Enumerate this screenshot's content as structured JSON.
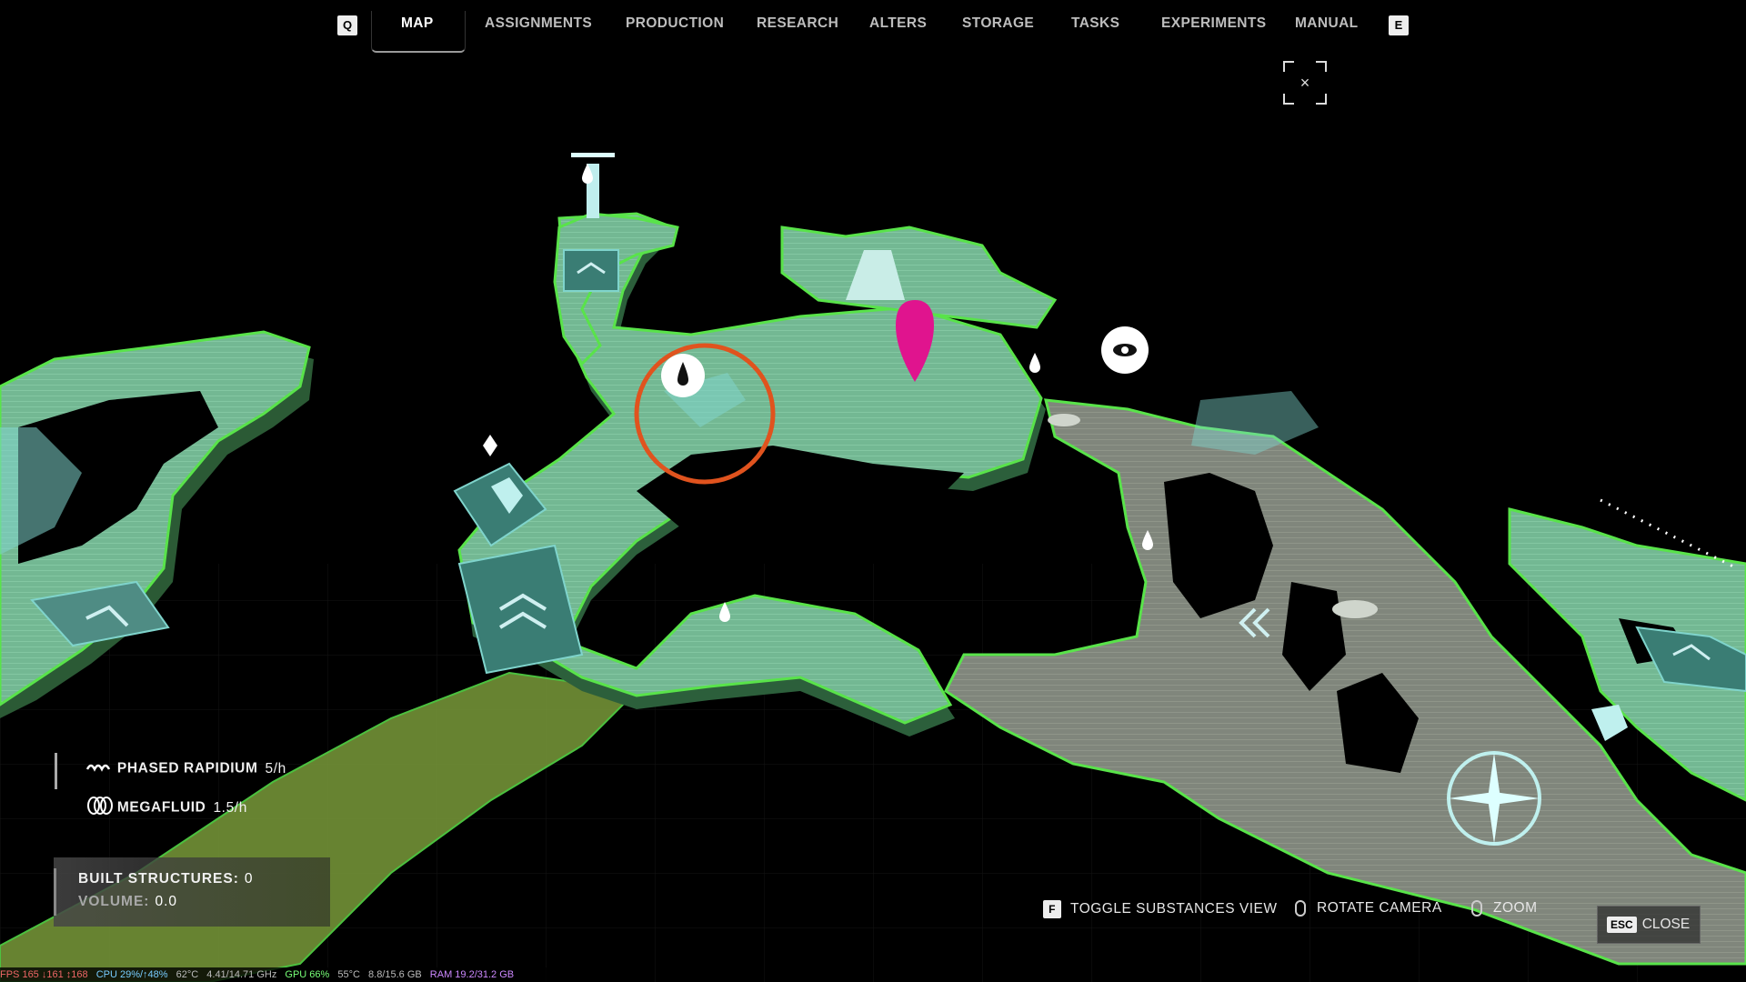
{
  "nav": {
    "left_key": "Q",
    "right_key": "E",
    "tabs": [
      "MAP",
      "ASSIGNMENTS",
      "PRODUCTION",
      "RESEARCH",
      "ALTERS",
      "STORAGE",
      "TASKS",
      "EXPERIMENTS",
      "MANUAL"
    ],
    "active_tab": "MAP"
  },
  "close_icon_glyph": "×",
  "resources": [
    {
      "icon": "wave-icon",
      "name": "PHASED RAPIDIUM",
      "rate": "5/h"
    },
    {
      "icon": "megafluid-icon",
      "name": "MEGAFLUID",
      "rate": "1.5/h"
    }
  ],
  "structures": {
    "built_label": "BUILT STRUCTURES:",
    "built_value": "0",
    "volume_label": "VOLUME:",
    "volume_value": "0.0"
  },
  "controls": {
    "toggle_key": "F",
    "toggle_label": "TOGGLE SUBSTANCES VIEW",
    "rotate_label": "ROTATE CAMERA",
    "zoom_label": "ZOOM",
    "close_key": "ESC",
    "close_label": "CLOSE"
  },
  "perf": {
    "fps": "FPS 165 ↓161 ↕168",
    "cpu": "CPU 29%/↑48%",
    "cpu_temp": "62°C",
    "cpu_clock": "4.41/14.71 GHz",
    "gpu": "GPU 66%",
    "gpu_temp": "55°C",
    "vram": "8.8/15.6 GB",
    "ram": "RAM 19.2/31.2 GB"
  },
  "colors": {
    "land_fill": "#6cae8c",
    "land_edge": "#59e34a",
    "land_dark": "#3c6a4c",
    "grey_zone": "#7d8475",
    "pin_magenta": "#e0148e",
    "target_ring": "#e0531e"
  }
}
